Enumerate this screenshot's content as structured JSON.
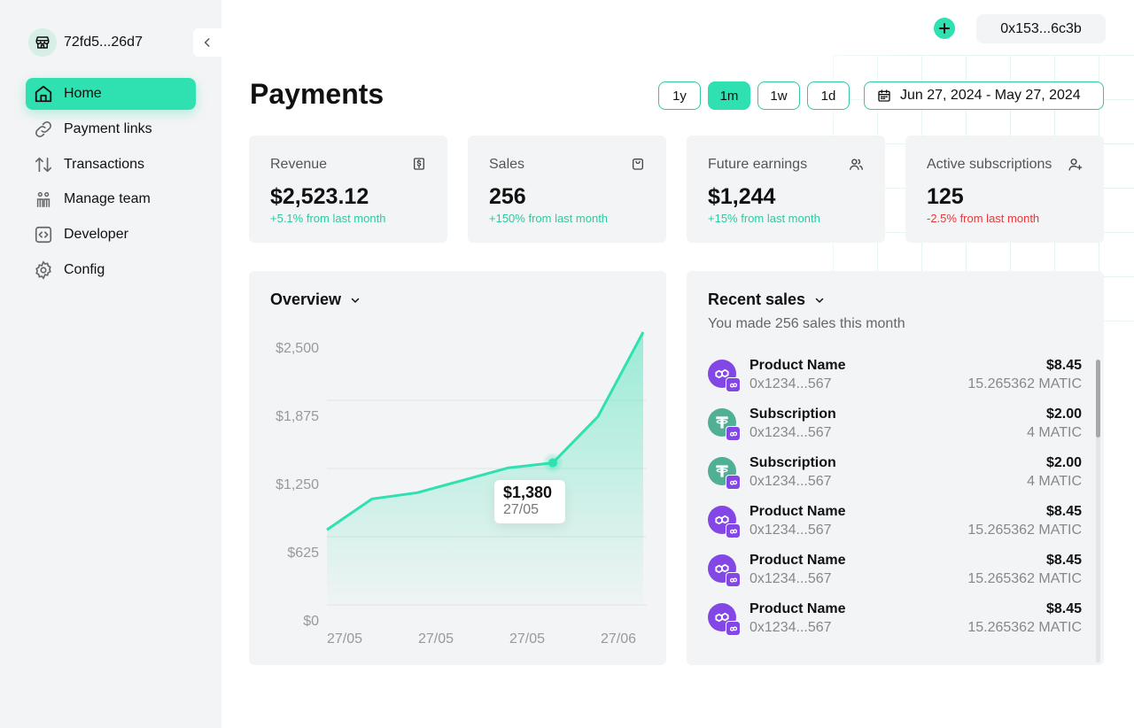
{
  "sidebar": {
    "store_name": "72fd5...26d7",
    "items": [
      {
        "label": "Home",
        "icon": "home-icon",
        "active": true
      },
      {
        "label": "Payment links",
        "icon": "link-icon"
      },
      {
        "label": "Transactions",
        "icon": "arrows-icon"
      },
      {
        "label": "Manage team",
        "icon": "team-icon"
      },
      {
        "label": "Developer",
        "icon": "code-icon"
      },
      {
        "label": "Config",
        "icon": "gear-icon"
      }
    ]
  },
  "header": {
    "wallet": "0x153...6c3b",
    "title": "Payments",
    "ranges": [
      {
        "label": "1y",
        "active": false
      },
      {
        "label": "1m",
        "active": true
      },
      {
        "label": "1w",
        "active": false
      },
      {
        "label": "1d",
        "active": false
      }
    ],
    "date_range": "Jun 27, 2024 - May 27, 2024"
  },
  "stats": [
    {
      "title": "Revenue",
      "value": "$2,523.12",
      "change": "+5.1% from last month",
      "trend": "up",
      "icon": "dollar-icon"
    },
    {
      "title": "Sales",
      "value": "256",
      "change": "+150% from last month",
      "trend": "up",
      "icon": "bag-icon"
    },
    {
      "title": "Future earnings",
      "value": "$1,244",
      "change": "+15% from last month",
      "trend": "up",
      "icon": "users-icon"
    },
    {
      "title": "Active subscriptions",
      "value": "125",
      "change": "-2.5% from last month",
      "trend": "down",
      "icon": "user-plus-icon"
    }
  ],
  "overview": {
    "title": "Overview",
    "tooltip": {
      "value": "$1,380",
      "date": "27/05"
    }
  },
  "chart_data": {
    "type": "area",
    "title": "Overview",
    "x": [
      "27/05",
      "27/05",
      "27/05",
      "27/06"
    ],
    "y_ticks": [
      "$0",
      "$625",
      "$1,250",
      "$1,875",
      "$2,500"
    ],
    "ylim": [
      0,
      2500
    ],
    "series": [
      {
        "values": [
          730,
          1030,
          1090,
          1210,
          1330,
          1380,
          1830,
          2650
        ]
      }
    ],
    "highlight_index": 5,
    "color": "#2fe0b0",
    "grid": true
  },
  "recent_sales": {
    "title": "Recent sales",
    "subtitle": "You made 256 sales this month",
    "items": [
      {
        "name": "Product Name",
        "address": "0x1234...567",
        "amount": "$8.45",
        "sub": "15.265362 MATIC",
        "icon": "matic-icon"
      },
      {
        "name": "Subscription",
        "address": "0x1234...567",
        "amount": "$2.00",
        "sub": "4 MATIC",
        "icon": "tether-icon"
      },
      {
        "name": "Subscription",
        "address": "0x1234...567",
        "amount": "$2.00",
        "sub": "4 MATIC",
        "icon": "tether-icon"
      },
      {
        "name": "Product Name",
        "address": "0x1234...567",
        "amount": "$8.45",
        "sub": "15.265362 MATIC",
        "icon": "matic-icon"
      },
      {
        "name": "Product Name",
        "address": "0x1234...567",
        "amount": "$8.45",
        "sub": "15.265362 MATIC",
        "icon": "matic-icon"
      },
      {
        "name": "Product Name",
        "address": "0x1234...567",
        "amount": "$8.45",
        "sub": "15.265362 MATIC",
        "icon": "matic-icon"
      }
    ]
  },
  "colors": {
    "accent": "#2fe0b0",
    "negative": "#e5383b",
    "matic": "#8247e5",
    "tether": "#50af95"
  }
}
